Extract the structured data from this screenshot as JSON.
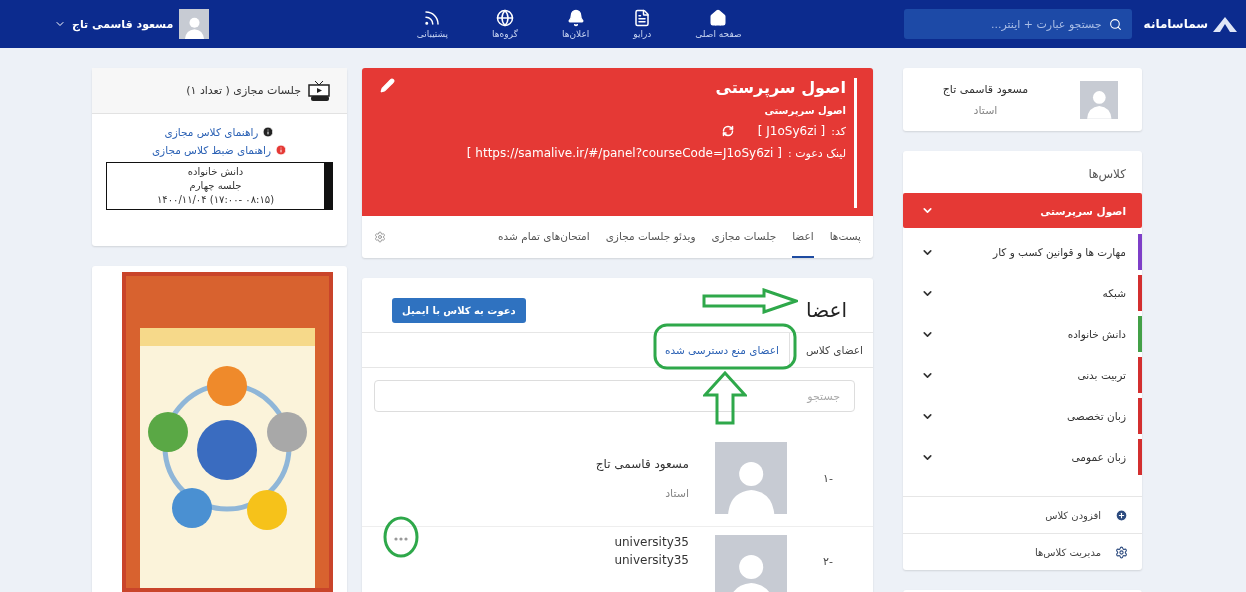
{
  "navbar": {
    "logo": "سماسامانه",
    "search": {
      "placeholder": "جستجو عبارت + اینتر..."
    },
    "items": [
      {
        "label": "صفحه اصلی",
        "kind": "home"
      },
      {
        "label": "درایو",
        "kind": "drive"
      },
      {
        "label": "اعلان‌ها",
        "kind": "bell"
      },
      {
        "label": "گروه‌ها",
        "kind": "groups"
      },
      {
        "label": "پشتیبانی",
        "kind": "rss"
      }
    ],
    "user": {
      "name": "مسعود قاسمی تاج"
    }
  },
  "profile": {
    "name": "مسعود قاسمی تاج",
    "role": "استاد"
  },
  "classes": {
    "title": "کلاس‌ها",
    "items": [
      {
        "label": "اصول سرپرستی",
        "selected": true,
        "color": "#e53935"
      },
      {
        "label": "مهارت ها و قوانین کسب و کار",
        "selected": false,
        "color": "#7e3fc8"
      },
      {
        "label": "شبکه",
        "selected": false,
        "color": "#d32f2f"
      },
      {
        "label": "دانش خانواده",
        "selected": false,
        "color": "#43a047"
      },
      {
        "label": "تربیت بدنی",
        "selected": false,
        "color": "#d32f2f"
      },
      {
        "label": "زبان تخصصی",
        "selected": false,
        "color": "#d32f2f"
      },
      {
        "label": "زبان عمومی",
        "selected": false,
        "color": "#d32f2f"
      }
    ],
    "actions": [
      {
        "label": "افزودن کلاس",
        "kind": "add"
      },
      {
        "label": "مدیریت کلاس‌ها",
        "kind": "settings"
      }
    ]
  },
  "course": {
    "title": "اصول سرپرستی",
    "subtitle": "اصول سرپرستی",
    "code_label": "کد:",
    "code": "[ J1oSy6zi ]",
    "invite_label": "لینک دعوت :",
    "invite_link": "[ https://samalive.ir/#/panel?courseCode=J1oSy6zi ]",
    "tabs": [
      {
        "label": "پست‌ها",
        "selected": false
      },
      {
        "label": "اعضا",
        "selected": true
      },
      {
        "label": "جلسات مجازی",
        "selected": false
      },
      {
        "label": "ویدئو جلسات مجازی",
        "selected": false
      },
      {
        "label": "امتحان‌های تمام شده",
        "selected": false
      }
    ]
  },
  "members": {
    "title": "اعضا",
    "invite_button": "دعوت به کلاس با ایمیل",
    "subtabs": [
      {
        "label": "اعضای کلاس",
        "selected": true
      },
      {
        "label": "اعضای منع دسترسی شده",
        "selected": false
      }
    ],
    "search": {
      "placeholder": "جستجو"
    },
    "rows": [
      {
        "index": "-۱",
        "name": "مسعود قاسمی تاج",
        "role": "استاد",
        "has_menu": false
      },
      {
        "index": "-۲",
        "name": "university35",
        "role": "university35",
        "has_menu": true
      }
    ]
  },
  "sessions": {
    "title": "جلسات مجازی ( تعداد ۱)",
    "links": [
      {
        "label": "راهنمای کلاس مجازی",
        "kind": "info"
      },
      {
        "label": "راهنمای ضبط کلاس مجازی",
        "kind": "record"
      }
    ],
    "event": {
      "lines": [
        "دانش خانواده",
        "جلسه چهارم"
      ],
      "date": "۱۴۰۰/۱۱/۰۴ (۱۷:۰۰- ۰۸:۱۵)"
    }
  }
}
